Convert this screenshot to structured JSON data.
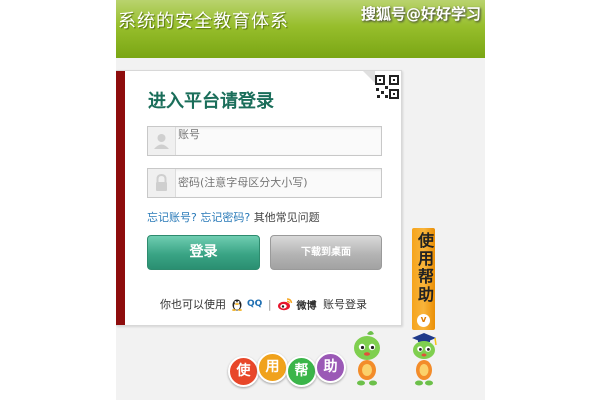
{
  "header": {
    "slogan": "系统的安全教育体系",
    "watermark": "搜狐号@好好学习"
  },
  "login": {
    "title": "进入平台请登录",
    "account_placeholder": "账号",
    "password_placeholder": "密码(注意字母区分大小写)",
    "forgot_account": "忘记账号?",
    "forgot_password": "忘记密码?",
    "other_issues": "其他常见问题",
    "login_button": "登录",
    "download_button": "下载到桌面",
    "alt_prefix": "你也可以使用",
    "qq_label": "QQ",
    "separator": "|",
    "weibo_label": "微博",
    "alt_suffix": "账号登录"
  },
  "help": {
    "tab_label": "使用帮助",
    "tab_arrow": "v",
    "banner_chars": [
      "使",
      "用",
      "帮",
      "助"
    ]
  },
  "colors": {
    "header_green": "#97be2c",
    "title_teal": "#1a6e5a",
    "panel_stripe": "#8e0d0d",
    "login_button": "#3aa485",
    "help_tab_orange": "#f6a41c",
    "link_blue": "#2a7ab8",
    "banner_colors": [
      "#e8472a",
      "#f0a21c",
      "#3bb54a",
      "#9b59b6"
    ]
  },
  "icons": {
    "account": "user-icon",
    "password": "lock-icon",
    "qq": "qq-penguin-icon",
    "weibo": "weibo-icon",
    "qr": "qr-code-icon",
    "mascot": "mascot-icon"
  }
}
